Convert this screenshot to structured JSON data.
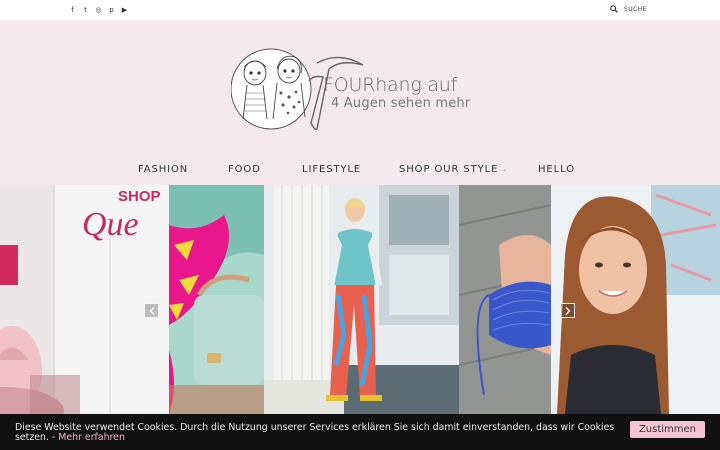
{
  "topbar": {
    "social_icons": [
      "facebook-icon",
      "twitter-icon",
      "instagram-icon",
      "pinterest-icon",
      "youtube-icon"
    ],
    "social_glyphs": [
      "f",
      "t",
      "◎",
      "p",
      "▶"
    ],
    "search_label": "SUCHE"
  },
  "header": {
    "logo_title": "FOURhang auf",
    "logo_subtitle": "4 Augen sehen mehr",
    "background": "#f5e9ee"
  },
  "nav": {
    "items": [
      {
        "label": "FASHION"
      },
      {
        "label": "FOOD"
      },
      {
        "label": "LIFESTYLE"
      },
      {
        "label": "SHOP OUR STYLE",
        "has_dropdown": true
      },
      {
        "label": "HELLO"
      }
    ]
  },
  "slider": {
    "slide1_sign_top": "SHOP",
    "slide1_sign_script": "Que"
  },
  "cookie": {
    "text": "Diese Website verwendet Cookies. Durch die Nutzung unserer Services erklären Sie sich damit einverstanden, dass wir Cookies setzen. - ",
    "link": "Mehr erfahren",
    "button": "Zustimmen",
    "accent": "#f6c4d3"
  }
}
